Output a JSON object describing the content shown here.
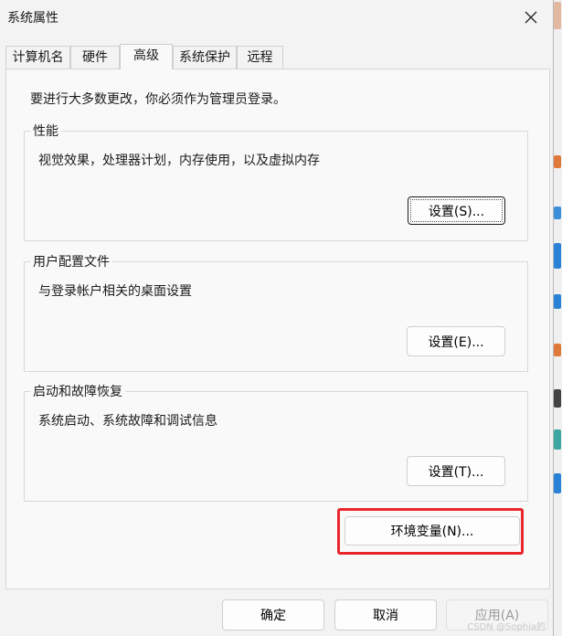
{
  "window": {
    "title": "系统属性"
  },
  "tabs": [
    {
      "label": "计算机名"
    },
    {
      "label": "硬件"
    },
    {
      "label": "高级",
      "active": true
    },
    {
      "label": "系统保护"
    },
    {
      "label": "远程"
    }
  ],
  "notice": "要进行大多数更改，你必须作为管理员登录。",
  "groups": {
    "performance": {
      "title": "性能",
      "description": "视觉效果，处理器计划，内存使用，以及虚拟内存",
      "button": "设置(S)..."
    },
    "profiles": {
      "title": "用户配置文件",
      "description": "与登录帐户相关的桌面设置",
      "button": "设置(E)..."
    },
    "startup": {
      "title": "启动和故障恢复",
      "description": "系统启动、系统故障和调试信息",
      "button": "设置(T)..."
    }
  },
  "env_button": "环境变量(N)...",
  "footer": {
    "ok": "确定",
    "cancel": "取消",
    "apply": "应用(A)"
  },
  "watermark": "CSDN @Sophia的",
  "colors": {
    "highlight": "#e8262b"
  },
  "icons": {
    "close": "close-icon"
  }
}
